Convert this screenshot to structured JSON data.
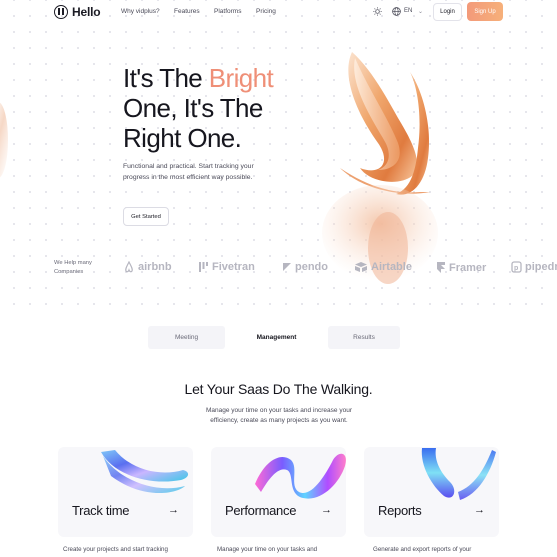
{
  "nav": {
    "logo_text": "Hello",
    "links": [
      "Why vidplus?",
      "Features",
      "Platforms",
      "Pricing"
    ],
    "language": "EN",
    "login_label": "Login",
    "signup_label": "Sign Up",
    "icons": [
      "sun-icon",
      "globe-icon",
      "chevron-down-icon"
    ]
  },
  "hero": {
    "title_part1": "It's The ",
    "title_accent": "Bright",
    "title_line2": "One, It's The",
    "title_line3": "Right One.",
    "subtitle": "Functional and practical. Start tracking your progress in the most efficient way possible.",
    "cta_label": "Get Started"
  },
  "logos": {
    "label": "We Help many Companies",
    "brands": [
      "airbnb",
      "Fivetran",
      "pendo",
      "Airtable",
      "Framer",
      "pipedrive"
    ]
  },
  "tabs": [
    {
      "label": "Meeting",
      "active": false
    },
    {
      "label": "Management",
      "active": true
    },
    {
      "label": "Results",
      "active": false
    }
  ],
  "section": {
    "title": "Let Your Saas Do The Walking.",
    "subtitle": "Manage your time on your tasks and increase your efficiency, create as many projects as you want."
  },
  "cards": [
    {
      "title": "Track time",
      "description": "Create your projects and start tracking"
    },
    {
      "title": "Performance",
      "description": "Manage your time on your tasks and"
    },
    {
      "title": "Reports",
      "description": "Generate and export reports of your"
    }
  ],
  "colors": {
    "accent": "#ef8f77",
    "signup_gradient_start": "#f39a7a",
    "signup_gradient_end": "#f6b07a",
    "muted_logo": "#b6b6c0"
  }
}
